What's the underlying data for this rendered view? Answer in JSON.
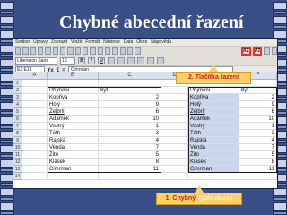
{
  "slide": {
    "title": "Chybné abecední řazení"
  },
  "app": {
    "menu": [
      "Soubor",
      "Úpravy",
      "Zobrazit",
      "Vložit",
      "Formát",
      "Nástroje",
      "Data",
      "Okno",
      "Nápověda"
    ],
    "font_name": "Liberation Sans",
    "font_size": "10",
    "name_box": "E3:E13",
    "formula_value": "Cimrman",
    "sort_icon_label": "AZ"
  },
  "sheet": {
    "columns": [
      "A",
      "B",
      "C",
      "D",
      "E",
      "F"
    ],
    "row_numbers": [
      "1",
      "2",
      "3",
      "4",
      "5",
      "6",
      "7",
      "8",
      "9",
      "10",
      "11",
      "12",
      "13",
      "14"
    ],
    "header_row": {
      "left_name": "Příjmení",
      "left_value": "byt",
      "right_name": "Příjmení",
      "right_value": "byt"
    },
    "left_rows": [
      {
        "name": "Kopřiva",
        "value": "2"
      },
      {
        "name": "Holý",
        "value": "9"
      },
      {
        "name": "Zejbrlí",
        "value": "6"
      },
      {
        "name": "Adámek",
        "value": "10"
      },
      {
        "name": "Vostrý",
        "value": "1"
      },
      {
        "name": "Tóth",
        "value": "3"
      },
      {
        "name": "Rajská",
        "value": "4"
      },
      {
        "name": "Venda",
        "value": "7"
      },
      {
        "name": "Žito",
        "value": "5"
      },
      {
        "name": "Klásek",
        "value": "8"
      },
      {
        "name": "Cimrman",
        "value": "11"
      }
    ],
    "right_rows": [
      {
        "name": "Kopřiva",
        "value": "2"
      },
      {
        "name": "Holý",
        "value": "9"
      },
      {
        "name": "Zejbrlí",
        "value": "6"
      },
      {
        "name": "Adámek",
        "value": "10"
      },
      {
        "name": "Vostrý",
        "value": "1"
      },
      {
        "name": "Tóth",
        "value": "3"
      },
      {
        "name": "Rajská",
        "value": "4"
      },
      {
        "name": "Venda",
        "value": "7"
      },
      {
        "name": "Žito",
        "value": "5"
      },
      {
        "name": "Klásek",
        "value": "8"
      },
      {
        "name": "Cimrman",
        "value": "11"
      }
    ]
  },
  "callouts": {
    "buttons": "2. Tlačítka řazení",
    "selection_lead": "1. Chybný",
    "selection_rest": " výběr oblasti"
  },
  "colors": {
    "background": "#3a4f86",
    "callout": "#ffd06a",
    "callout_text": "#c81e1e",
    "highlight_border": "#ff2b2b"
  }
}
